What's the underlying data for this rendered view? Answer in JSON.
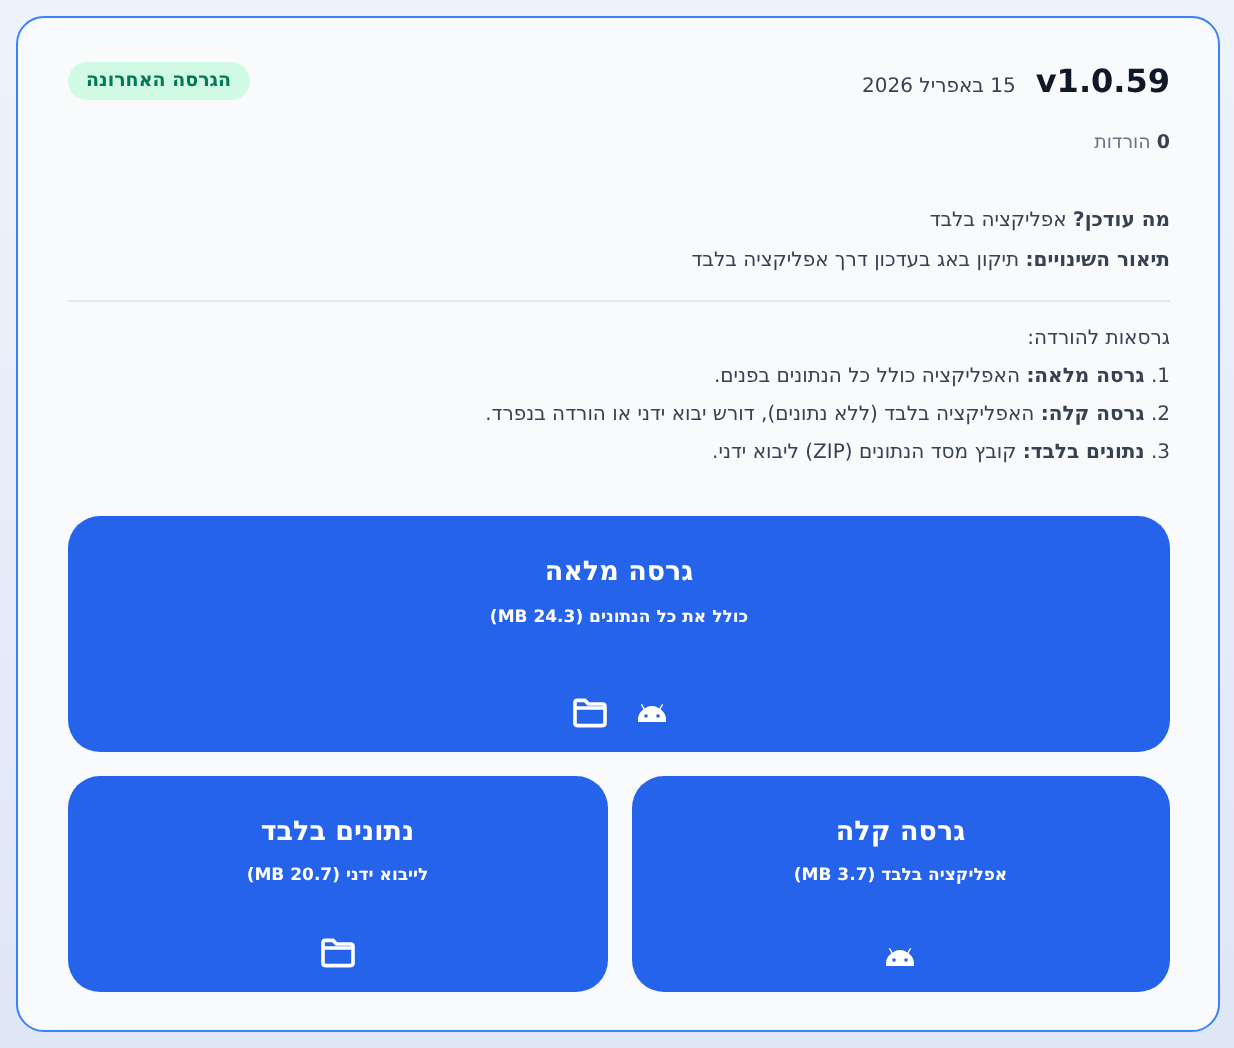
{
  "release": {
    "version": "v1.0.59",
    "date": "15 באפריל 2026",
    "badge": "הגרסה האחרונה",
    "downloads": "**0** הורדות"
  },
  "notes": [
    "**מה עודכן?** אפליקציה בלבד",
    "**תיאור השינויים:** תיקון באג בעדכון דרך אפליקציה בלבד"
  ],
  "versions_heading": "גרסאות להורדה:",
  "versions": [
    "1. **גרסה מלאה:** האפליקציה כולל כל הנתונים בפנים.",
    "2. **גרסה קלה:** האפליקציה בלבד (ללא נתונים), דורש יבוא ידני או הורדה בנפרד.",
    "3. **נתונים בלבד:** קובץ מסד הנתונים (ZIP) ליבוא ידני."
  ],
  "download_buttons": [
    {
      "title": "גרסה מלאה",
      "subtitle": "כולל את כל הנתונים (24.3 MB)",
      "icons": [
        {
          "kind": "android"
        },
        {
          "kind": "folder"
        }
      ]
    },
    {
      "title": "גרסה קלה",
      "subtitle": "אפליקציה בלבד (3.7 MB)",
      "icons": [
        {
          "kind": "android"
        }
      ]
    },
    {
      "title": "נתונים בלבד",
      "subtitle": "לייבוא ידני (20.7 MB)",
      "icons": [
        {
          "kind": "folder"
        }
      ]
    }
  ]
}
